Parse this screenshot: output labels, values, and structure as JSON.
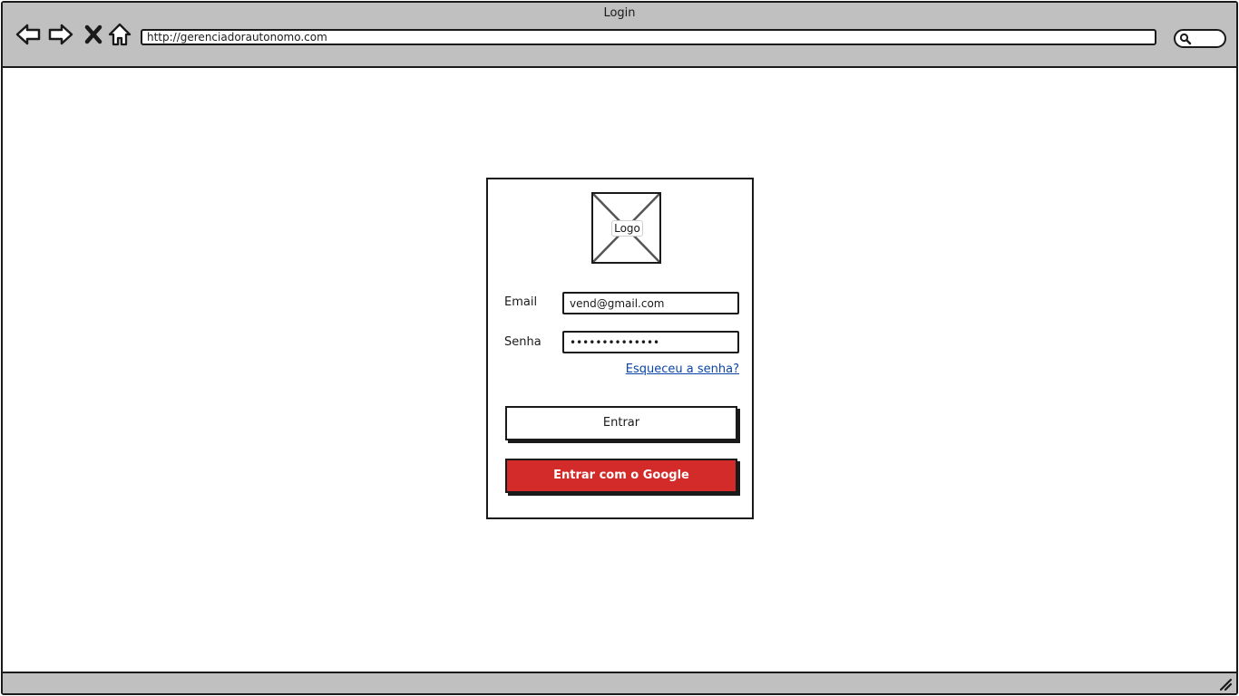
{
  "browser": {
    "title": "Login",
    "url": "http://gerenciadorautonomo.com"
  },
  "login": {
    "logo_label": "Logo",
    "email_label": "Email",
    "email_value": "vend@gmail.com",
    "password_label": "Senha",
    "password_value": "••••••••••••••",
    "forgot_label": "Esqueceu a senha?",
    "submit_label": "Entrar",
    "google_label": "Entrar com o Google"
  },
  "colors": {
    "chrome": "#c0c0c0",
    "google_button": "#d32a2a",
    "link": "#0a46a8"
  },
  "icons": [
    "back-arrow-icon",
    "forward-arrow-icon",
    "close-icon",
    "home-icon",
    "search-icon",
    "resize-grip-icon",
    "image-placeholder-icon"
  ]
}
